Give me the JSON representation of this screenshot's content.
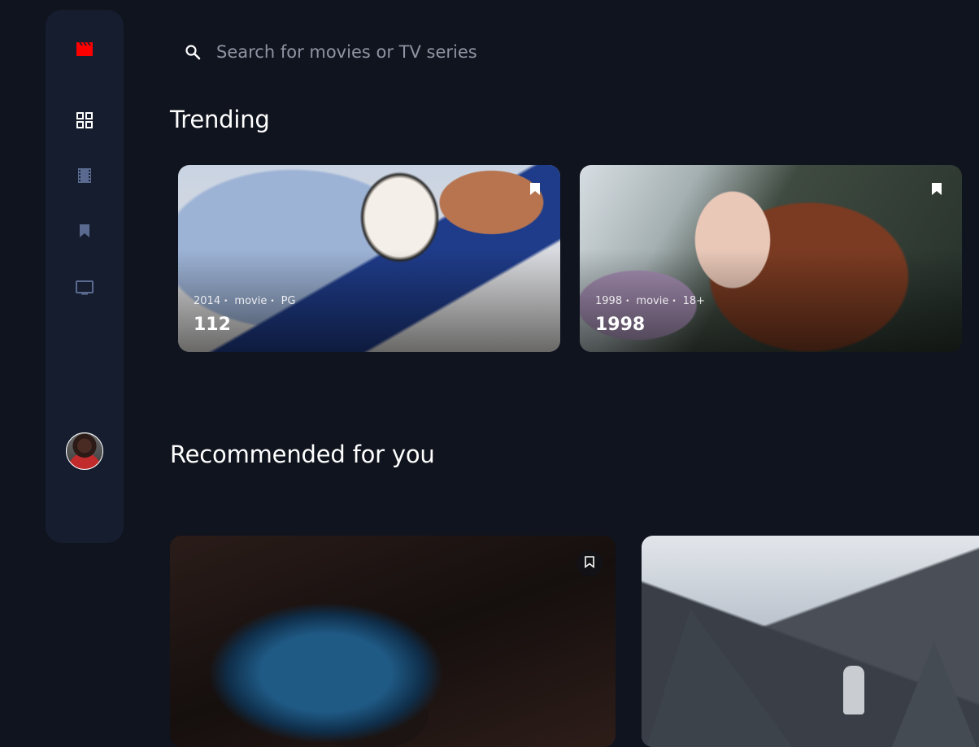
{
  "sidebar": {
    "logo_icon": "clapperboard-icon",
    "accent_color": "#fc4747",
    "inactive_color": "#5a698f",
    "items": [
      {
        "name": "home",
        "icon": "grid-icon",
        "active": true
      },
      {
        "name": "movies",
        "icon": "film-icon",
        "active": false
      },
      {
        "name": "bookmarks",
        "icon": "bookmark-icon",
        "active": false
      },
      {
        "name": "tv-series",
        "icon": "tv-icon",
        "active": false
      }
    ],
    "avatar": "user-avatar"
  },
  "search": {
    "placeholder": "Search for movies or TV series",
    "value": ""
  },
  "trending": {
    "title": "Trending",
    "items": [
      {
        "year": "2014",
        "category": "movie",
        "rating": "PG",
        "title": "112",
        "bookmarked": true
      },
      {
        "year": "1998",
        "category": "movie",
        "rating": "18+",
        "title": "1998",
        "bookmarked": true
      }
    ]
  },
  "recommended": {
    "title": "Recommended for you",
    "items": [
      {
        "bookmarked": false
      },
      {
        "bookmarked": false
      }
    ]
  }
}
